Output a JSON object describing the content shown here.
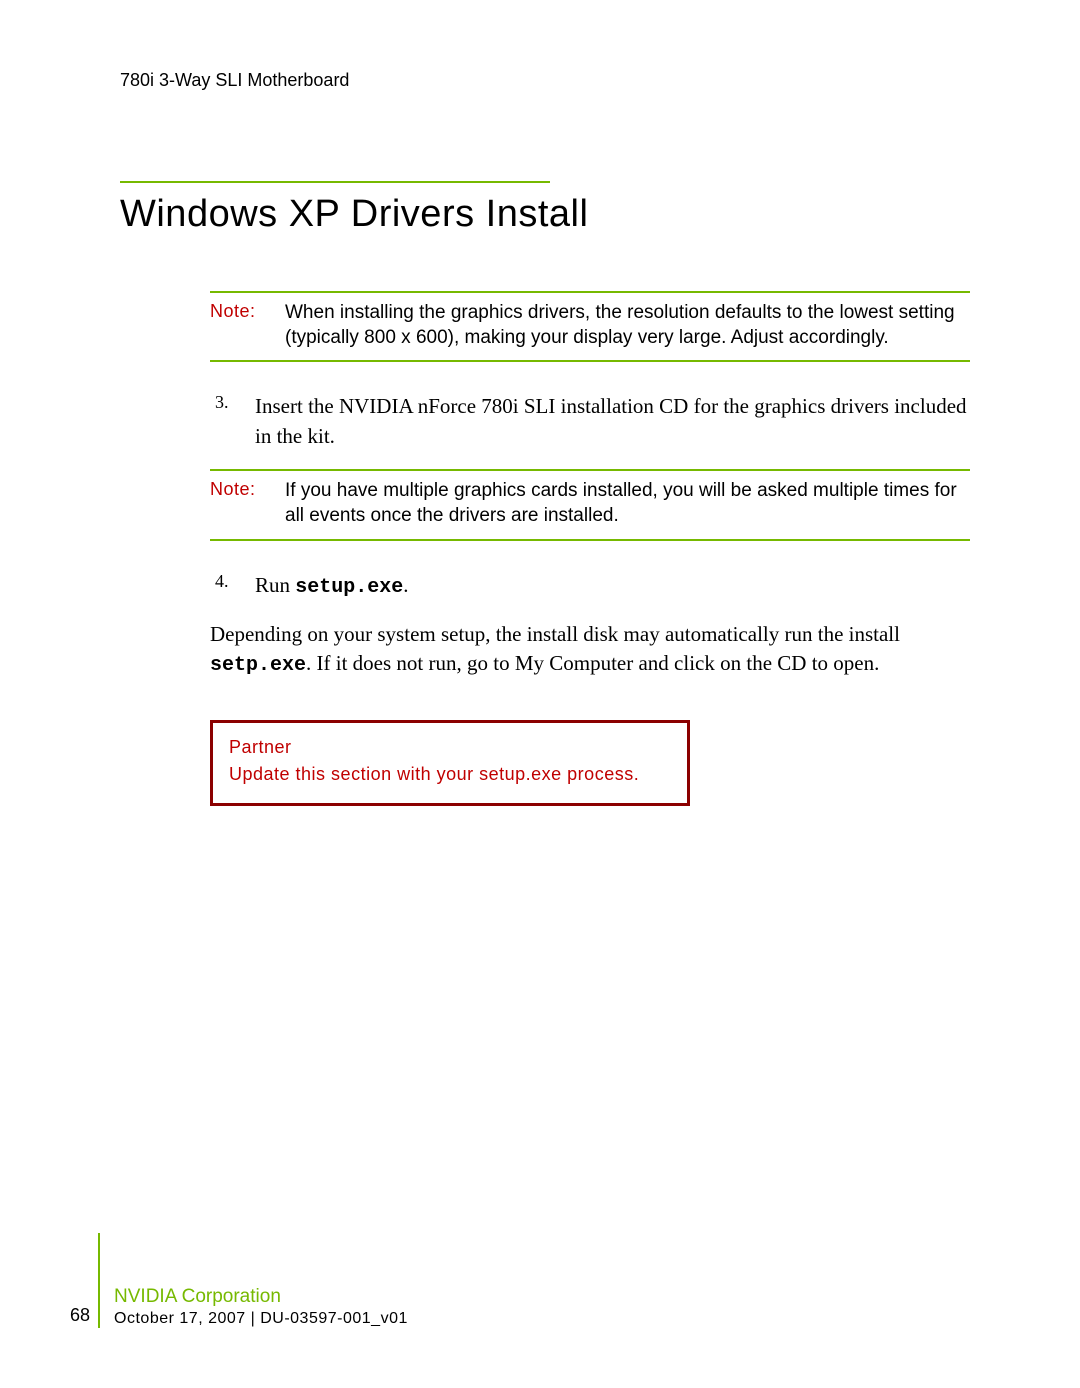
{
  "header": "780i 3-Way SLI Motherboard",
  "title": "Windows XP Drivers Install",
  "note1": {
    "label": "Note:",
    "text": "When installing the graphics drivers, the resolution defaults to the lowest setting (typically 800 x 600), making your display very large. Adjust accordingly."
  },
  "step3": {
    "num": "3.",
    "text": "Insert the NVIDIA nForce 780i SLI installation CD for the graphics drivers included in the kit."
  },
  "note2": {
    "label": "Note:",
    "text": "If you have multiple graphics cards installed, you will be asked multiple times for all events once the drivers are installed."
  },
  "step4": {
    "num": "4.",
    "pre": "Run ",
    "cmd": "setup.exe",
    "post": "."
  },
  "para": {
    "p1": "Depending on your system setup, the install disk may automatically run the install ",
    "cmd": "setp.exe",
    "p2": ". If it does not run, go to My Computer and click on the CD to open."
  },
  "partner": {
    "title": "Partner",
    "text": "Update this section with your setup.exe process."
  },
  "footer": {
    "page": "68",
    "company": "NVIDIA Corporation",
    "date": "October 17, 2007  |  DU-03597-001_v01"
  }
}
